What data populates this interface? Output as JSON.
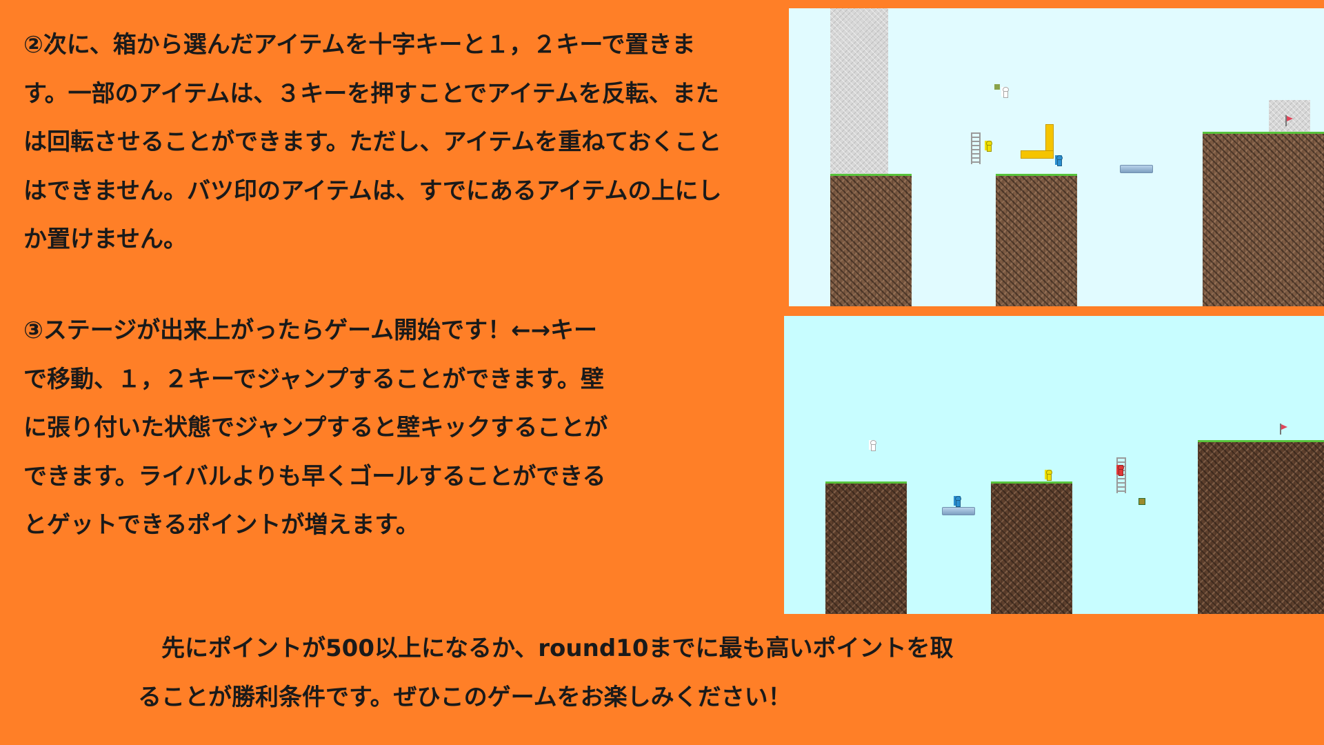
{
  "instructions": {
    "step2_lines": [
      "②次に、箱から選んだアイテムを十字キーと１，２キーで置きま",
      "す。一部のアイテムは、３キーを押すことでアイテムを反転、また",
      "は回転させることができます。ただし、アイテムを重ねておくこと",
      "はできません。バツ印のアイテムは、すでにあるアイテムの上にし",
      "か置けません。"
    ],
    "step3_lines": [
      "③ステージが出来上がったらゲーム開始です！←→キー",
      "で移動、１，２キーでジャンプすることができます。壁",
      "に張り付いた状態でジャンプすると壁キックすることが",
      "できます。ライバルよりも早くゴールすることができる",
      "とゲットできるポイントが増えます。"
    ],
    "win_condition_lines": [
      "　先にポイントが500以上になるか、round10までに最も高いポイントを取",
      "ることが勝利条件です。ぜひこのゲームをお楽しみください！"
    ]
  },
  "screenshots": {
    "placement_phase": {
      "characters": [
        "white",
        "yellow",
        "blue"
      ],
      "items": [
        "ladder",
        "L-shaped block",
        "floating platform",
        "goal flag"
      ]
    },
    "race_phase": {
      "characters": [
        "white",
        "blue",
        "yellow",
        "red"
      ],
      "items": [
        "floating platform",
        "ladder",
        "goal flag",
        "trap"
      ]
    }
  },
  "colors": {
    "background": "#ff7f27",
    "text": "#1a1a1a",
    "sky_top": "#e1fbff",
    "sky_bottom": "#c8fdff",
    "grass": "#58c33b",
    "dirt": "#7c5a42"
  }
}
